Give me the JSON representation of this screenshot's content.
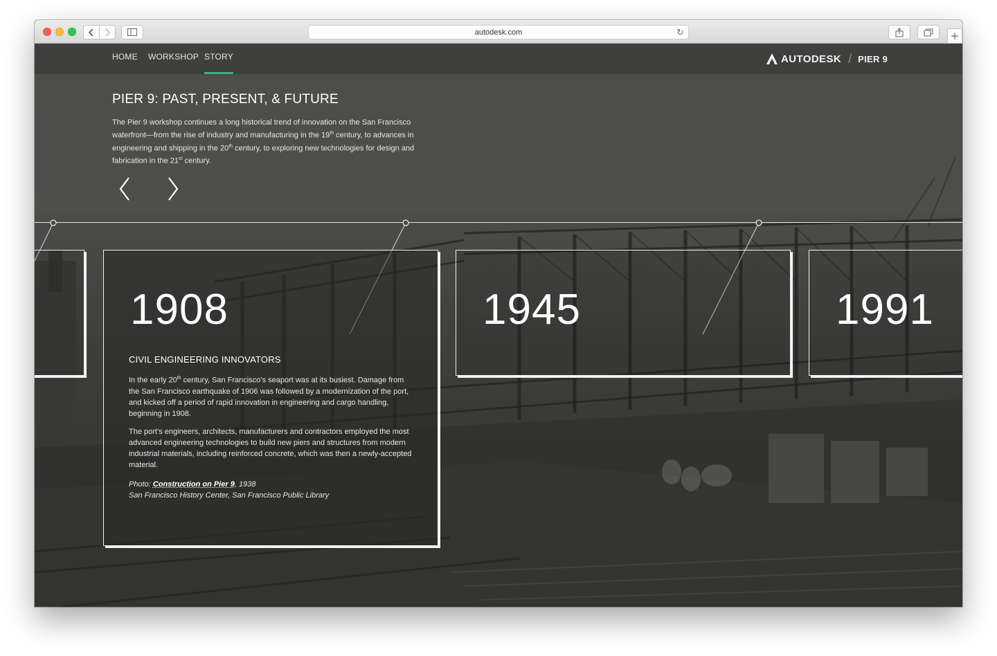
{
  "browser": {
    "url": "autodesk.com",
    "icons": {
      "back": "chevron-left-icon",
      "forward": "chevron-right-icon",
      "sidebar": "sidebar-icon",
      "reload": "reload-icon",
      "share": "share-icon",
      "tabs": "tabs-icon",
      "new_tab": "plus-icon"
    }
  },
  "nav": {
    "items": [
      {
        "label": "HOME"
      },
      {
        "label": "WORKSHOP"
      },
      {
        "label": "STORY",
        "active": true
      }
    ],
    "brand": "AUTODESK",
    "separator": "/",
    "sub_brand": "PIER 9",
    "accent_color": "#3fae8c"
  },
  "intro": {
    "title": "PIER 9: PAST, PRESENT, & FUTURE",
    "text_parts": [
      "The Pier 9 workshop continues a long historical trend of innovation on the San Francisco waterfront—from the rise of industry and manufacturing in the 19",
      "th",
      " century, to advances in engineering and shipping in the 20",
      "th",
      " century, to exploring new technologies for design and fabrication in the 21",
      "st",
      " century."
    ]
  },
  "timeline": {
    "cards": [
      {
        "year": "1908",
        "heading": "CIVIL ENGINEERING INNOVATORS",
        "para1_parts": [
          "In the early 20",
          "th",
          " century, San Francisco’s seaport was at its busiest. Damage from the San Francisco earthquake of 1906 was followed by a modernization of the port, and kicked off a period of rapid innovation in engineering and cargo handling, beginning in 1908."
        ],
        "para2": "The port’s engineers, architects, manufacturers and contractors employed the most advanced engineering technologies to build new piers and structures from modern industrial materials, including reinforced concrete, which was then a newly-accepted material.",
        "credit_prefix": "Photo: ",
        "credit_link": "Construction on Pier 9",
        "credit_suffix": ", 1938",
        "credit_source": "San Francisco History Center, San Francisco Public Library"
      },
      {
        "year": "1945"
      },
      {
        "year": "1991"
      }
    ]
  }
}
